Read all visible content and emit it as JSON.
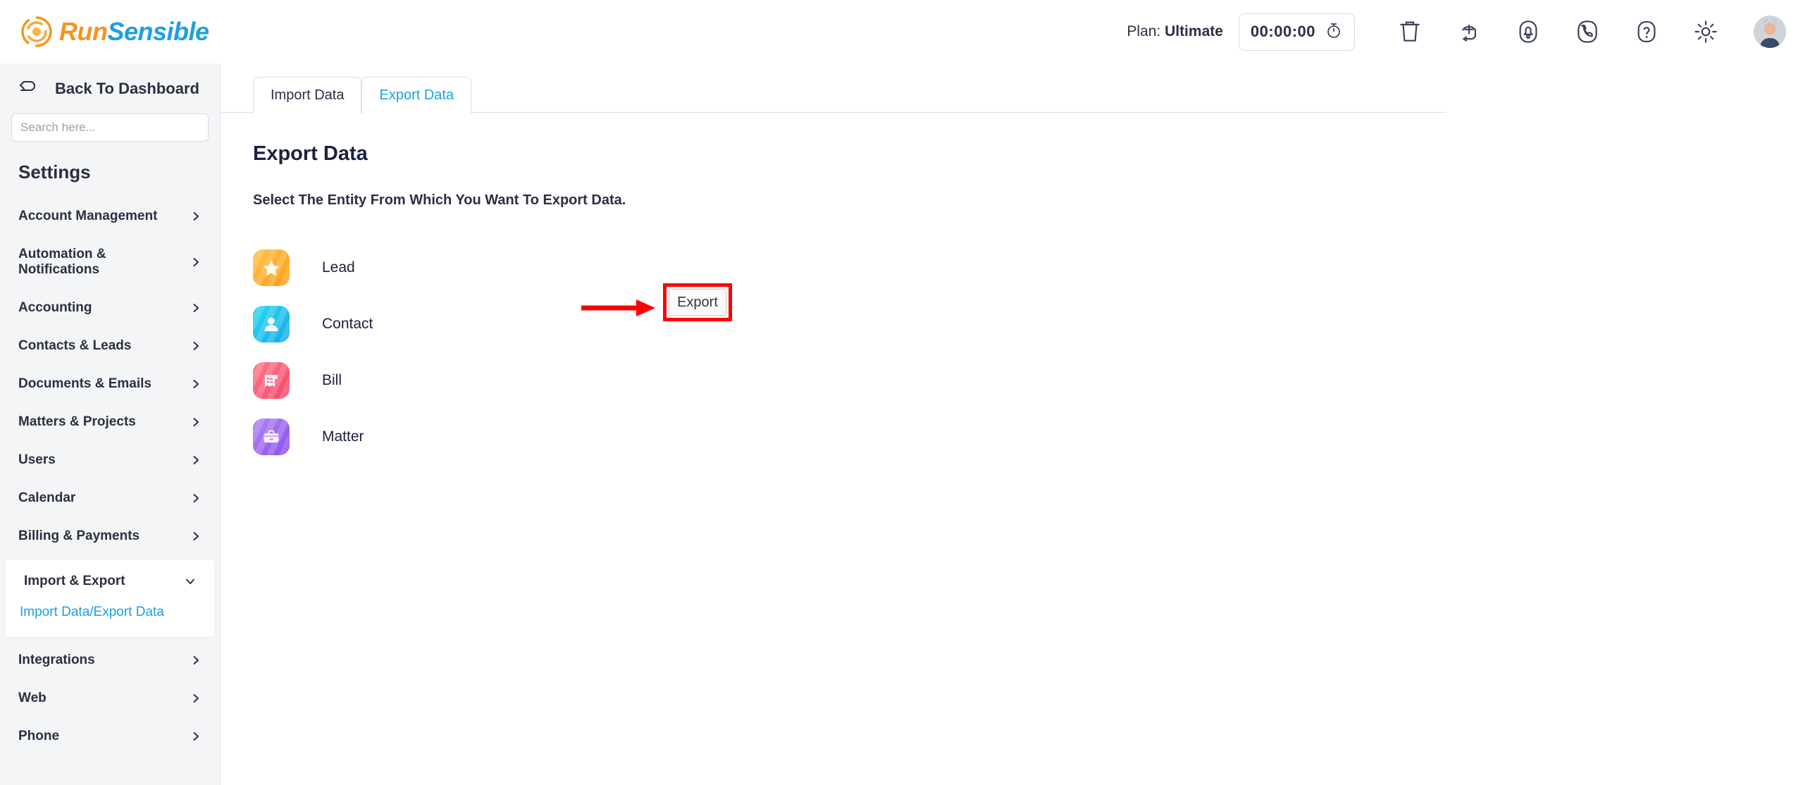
{
  "brand": {
    "name_part1": "Run",
    "name_part2": "Sensible",
    "logo_icon": "runsensible-swirl-icon",
    "orange": "#F7941E",
    "blue": "#1BA0E1"
  },
  "header": {
    "plan_prefix": "Plan:",
    "plan_value": "Ultimate",
    "timer_value": "00:00:00",
    "timer_icon": "stopwatch-icon",
    "icons": [
      {
        "name": "trash-icon"
      },
      {
        "name": "quick-add-icon"
      },
      {
        "name": "notification-bell-icon"
      },
      {
        "name": "phone-icon"
      },
      {
        "name": "help-question-icon"
      },
      {
        "name": "settings-gear-icon"
      }
    ],
    "avatar_alt": "user-avatar"
  },
  "sidebar": {
    "back_label": "Back To Dashboard",
    "back_icon": "back-arrow-icon",
    "search_placeholder": "Search here...",
    "search_value": "",
    "section_title": "Settings",
    "items": [
      {
        "label": "Account Management",
        "expanded": false
      },
      {
        "label": "Automation & Notifications",
        "expanded": false
      },
      {
        "label": "Accounting",
        "expanded": false
      },
      {
        "label": "Contacts & Leads",
        "expanded": false
      },
      {
        "label": "Documents & Emails",
        "expanded": false
      },
      {
        "label": "Matters & Projects",
        "expanded": false
      },
      {
        "label": "Users",
        "expanded": false
      },
      {
        "label": "Calendar",
        "expanded": false
      },
      {
        "label": "Billing & Payments",
        "expanded": false
      }
    ],
    "expanded_group": {
      "label": "Import & Export",
      "expanded": true,
      "sub_items": [
        {
          "label": "Import Data/Export Data",
          "active": true
        }
      ]
    },
    "items_after": [
      {
        "label": "Integrations",
        "expanded": false
      },
      {
        "label": "Web",
        "expanded": false
      },
      {
        "label": "Phone",
        "expanded": false
      }
    ]
  },
  "main": {
    "tabs": [
      {
        "label": "Import Data",
        "active": false
      },
      {
        "label": "Export Data",
        "active": true
      }
    ],
    "page_title": "Export Data",
    "page_subtitle": "Select The Entity From Which You Want To Export Data.",
    "entities": [
      {
        "label": "Lead",
        "icon": "star-icon",
        "color": "#FF9A14"
      },
      {
        "label": "Contact",
        "icon": "person-icon",
        "color": "#16A6E8"
      },
      {
        "label": "Bill",
        "icon": "receipt-icon",
        "color": "#F5436A"
      },
      {
        "label": "Matter",
        "icon": "briefcase-icon",
        "color": "#8A4BE8"
      }
    ],
    "export_button_label": "Export"
  },
  "annotation": {
    "arrow_color": "#FF0000",
    "highlight_color": "#FF0000",
    "target": "Export"
  }
}
